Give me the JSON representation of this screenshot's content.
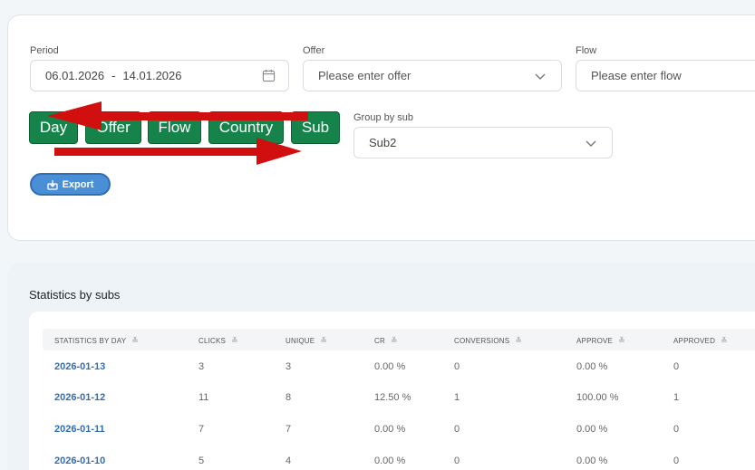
{
  "filters": {
    "period": {
      "label": "Period",
      "from": "06.01.2026",
      "separator": "-",
      "to": "14.01.2026"
    },
    "offer": {
      "label": "Offer",
      "placeholder": "Please enter offer"
    },
    "flow": {
      "label": "Flow",
      "placeholder": "Please enter flow"
    },
    "group_buttons": [
      "Day",
      "Offer",
      "Flow",
      "Country",
      "Sub"
    ],
    "group_by_sub": {
      "label": "Group by sub",
      "value": "Sub2"
    },
    "export_label": "Export"
  },
  "stats": {
    "title": "Statistics by subs",
    "columns": [
      "STATISTICS BY DAY",
      "CLICKS",
      "UNIQUE",
      "CR",
      "CONVERSIONS",
      "APPROVE",
      "APPROVED"
    ],
    "rows": [
      [
        "2026-01-13",
        "3",
        "3",
        "0.00 %",
        "0",
        "0.00 %",
        "0"
      ],
      [
        "2026-01-12",
        "11",
        "8",
        "12.50 %",
        "1",
        "100.00 %",
        "1"
      ],
      [
        "2026-01-11",
        "7",
        "7",
        "0.00 %",
        "0",
        "0.00 %",
        "0"
      ],
      [
        "2026-01-10",
        "5",
        "4",
        "0.00 %",
        "0",
        "0.00 %",
        "0"
      ]
    ]
  },
  "colors": {
    "group_button": "#16844a",
    "annotation_arrow": "#d10f0f",
    "export": "#4a8fd6",
    "link": "#2f6fb4"
  },
  "icons": [
    "calendar-icon",
    "chevron-down-icon",
    "download-icon",
    "sort-icon"
  ]
}
